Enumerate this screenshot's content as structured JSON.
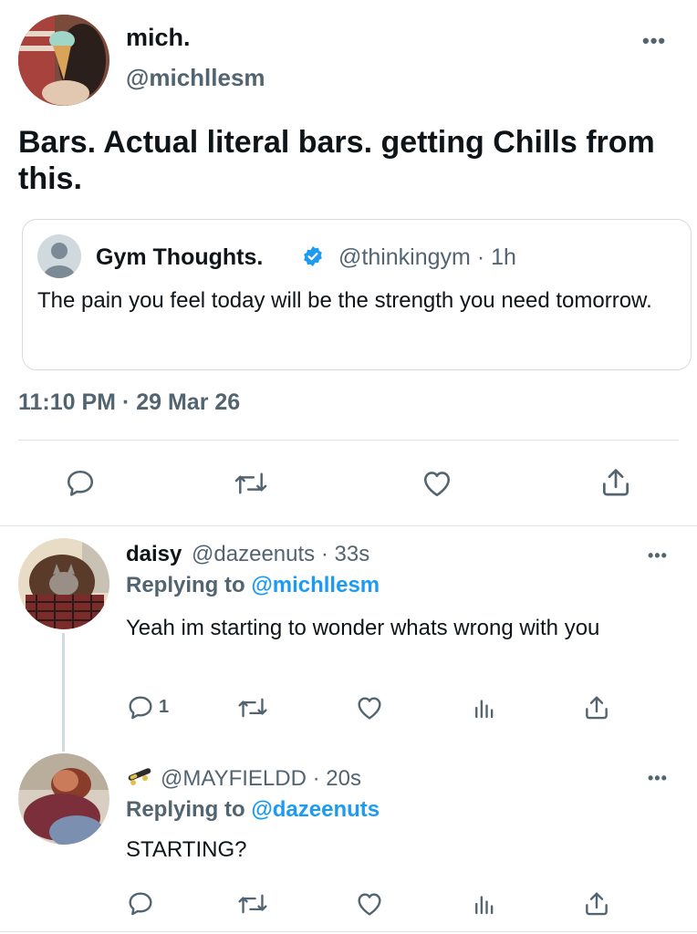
{
  "main_tweet": {
    "display_name": "mich.",
    "handle": "@michllesm",
    "text": "Bars. Actual literal bars. getting Chills from this.",
    "timestamp": "11:10 PM · 29 Mar 26",
    "more_label": "•••"
  },
  "quoted_tweet": {
    "display_name": "Gym Thoughts.",
    "handle_time": "@thinkingym · 1h",
    "text": "The pain you feel today will be the strength you need tomorrow."
  },
  "replies": [
    {
      "display_name": "daisy",
      "handle_time": "@dazeenuts · 33s",
      "replying_prefix": "Replying to",
      "replying_to": "@michllesm",
      "text": "Yeah im starting to wonder whats wrong with you",
      "reply_count": "1",
      "more_label": "•••"
    },
    {
      "display_name": "",
      "handle_time": "@MAYFIELDD · 20s",
      "replying_prefix": "Replying to",
      "replying_to": "@dazeenuts",
      "text": "STARTING?",
      "more_label": "•••"
    }
  ],
  "icons": [
    "reply-icon",
    "retweet-icon",
    "like-icon",
    "share-icon",
    "analytics-icon",
    "verified-badge-icon",
    "skateboard-icon",
    "more-icon"
  ],
  "colors": {
    "accent": "#1d9bf0",
    "muted": "#536471",
    "text": "#0f1419",
    "divider": "#dfe3e6"
  }
}
